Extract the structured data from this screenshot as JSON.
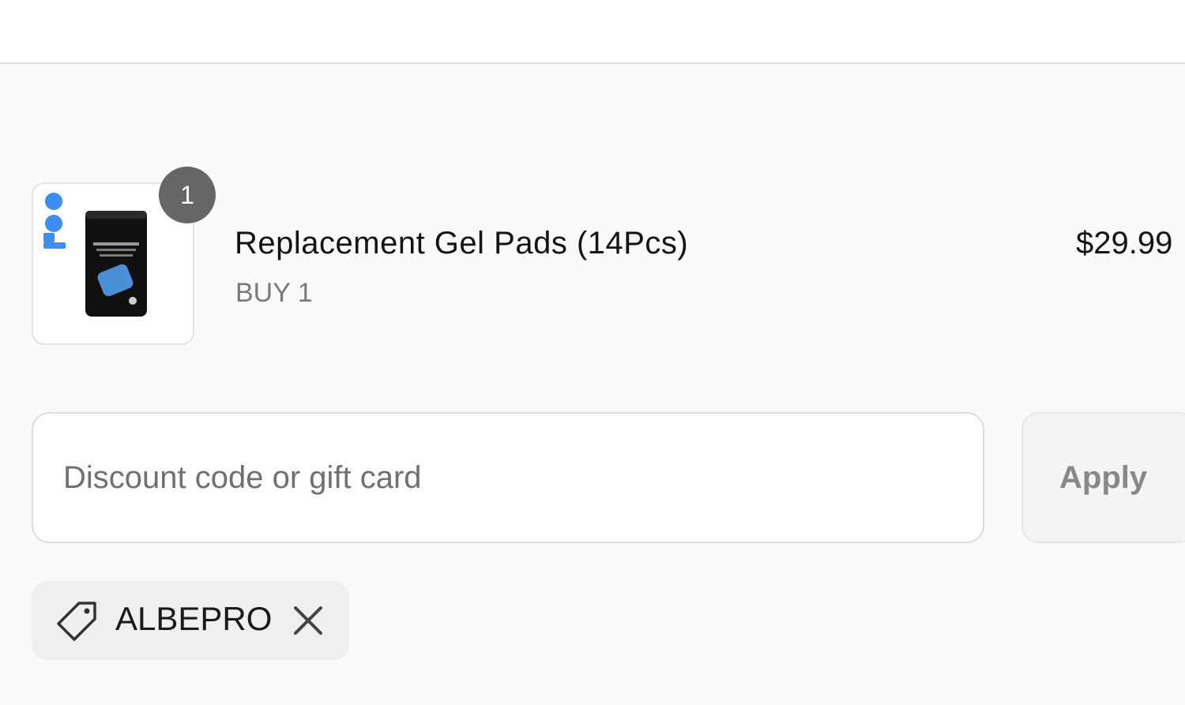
{
  "line_item": {
    "quantity": "1",
    "name": "Replacement Gel Pads (14Pcs)",
    "variant": "BUY 1",
    "price": "$29.99"
  },
  "discount": {
    "placeholder": "Discount code or gift card",
    "value": "",
    "apply_label": "Apply"
  },
  "applied_code": {
    "code": "ALBEPRO",
    "icon": "tag-icon",
    "remove_icon": "close-icon"
  }
}
